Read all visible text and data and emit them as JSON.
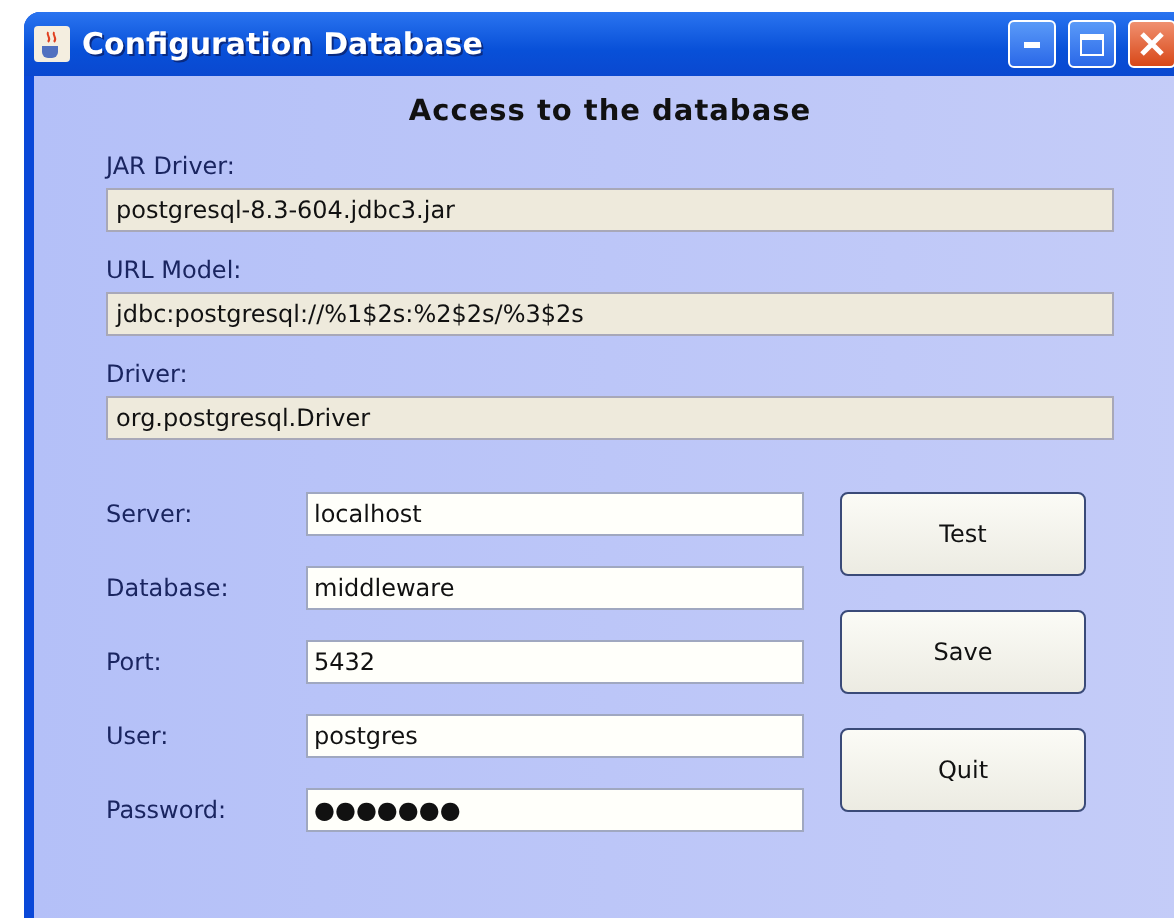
{
  "window": {
    "title": "Configuration Database"
  },
  "heading": "Access to the database",
  "info_fields": [
    {
      "label": "JAR Driver:",
      "value": "postgresql-8.3-604.jdbc3.jar"
    },
    {
      "label": "URL Model:",
      "value": "jdbc:postgresql://%1$2s:%2$2s/%3$2s"
    },
    {
      "label": "Driver:",
      "value": "org.postgresql.Driver"
    }
  ],
  "form_fields": [
    {
      "label": "Server:",
      "value": "localhost"
    },
    {
      "label": "Database:",
      "value": "middleware"
    },
    {
      "label": "Port:",
      "value": "5432"
    },
    {
      "label": "User:",
      "value": "postgres"
    },
    {
      "label": "Password:",
      "value": "●●●●●●●"
    }
  ],
  "buttons": [
    "Test",
    "Save",
    "Quit"
  ]
}
